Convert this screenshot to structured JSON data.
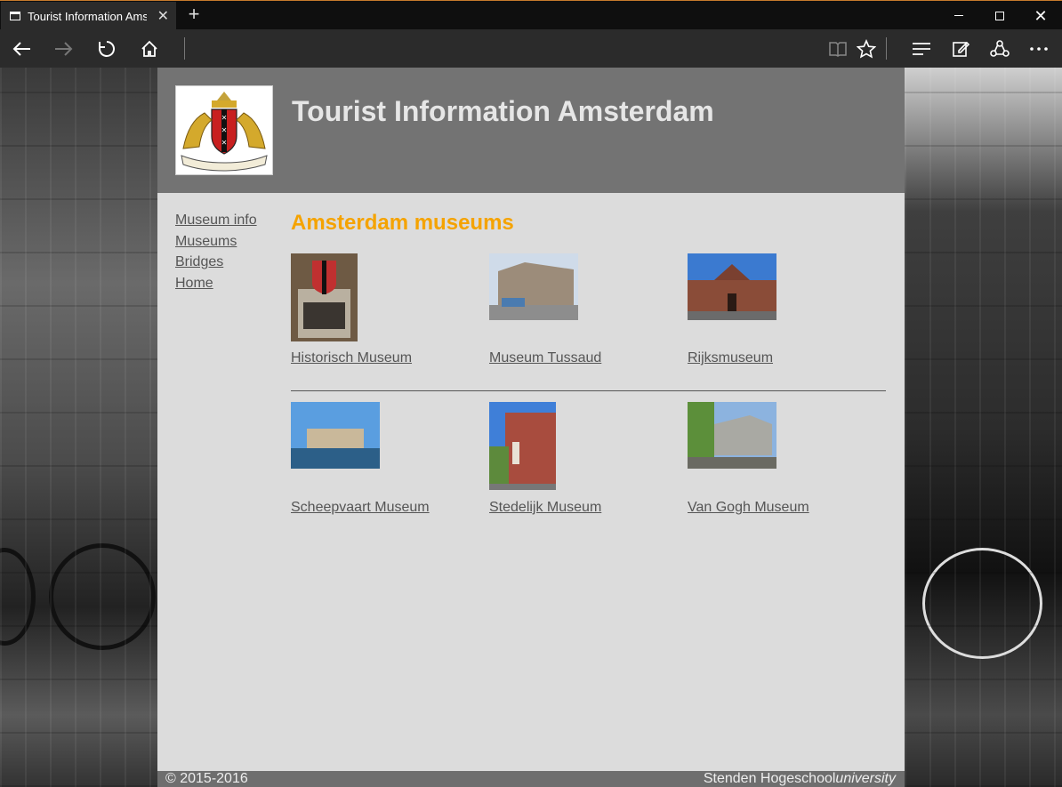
{
  "browser": {
    "tab_title": "Tourist Information Amst",
    "new_tab_symbol": "+",
    "close_tab_symbol": "✕",
    "icons": {
      "back": "back-arrow-icon",
      "forward": "forward-arrow-icon",
      "refresh": "refresh-icon",
      "home": "home-icon",
      "reading_view": "reading-view-icon",
      "favorite": "star-icon",
      "hub": "hub-icon",
      "notes": "web-note-icon",
      "share": "share-icon",
      "more": "more-icon"
    }
  },
  "header": {
    "title": "Tourist Information Amsterdam",
    "logo_icon": "amsterdam-coat-of-arms-icon"
  },
  "nav": {
    "items": [
      {
        "label": "Museum info"
      },
      {
        "label": "Museums"
      },
      {
        "label": "Bridges"
      },
      {
        "label": "Home"
      }
    ]
  },
  "main": {
    "title": "Amsterdam museums",
    "museums": [
      {
        "label": "Historisch Museum",
        "icon": "historisch-museum-photo",
        "color_a": "#8a6a4a",
        "color_b": "#c9c2b3"
      },
      {
        "label": "Museum Tussaud",
        "icon": "museum-tussaud-photo",
        "color_a": "#c8d8ea",
        "color_b": "#9a8a78"
      },
      {
        "label": "Rijksmuseum",
        "icon": "rijksmuseum-photo",
        "color_a": "#2c6fc7",
        "color_b": "#8a4a36"
      },
      {
        "label": "Scheepvaart Museum",
        "icon": "scheepvaart-museum-photo",
        "color_a": "#4d95d8",
        "color_b": "#2a5f86"
      },
      {
        "label": "Stedelijk Museum",
        "icon": "stedelijk-museum-photo",
        "color_a": "#2f6fd2",
        "color_b": "#a84a3c"
      },
      {
        "label": "Van Gogh Museum",
        "icon": "van-gogh-museum-photo",
        "color_a": "#6a9c42",
        "color_b": "#a7a7a2"
      }
    ]
  },
  "footer": {
    "copyright": "© 2015-2016",
    "credit_main": "Stenden Hogeschool",
    "credit_italic": "university"
  },
  "colors": {
    "title_orange": "#f5a300",
    "header_gray": "#737373",
    "content_bg": "#dcdcdc",
    "link_gray": "#555555"
  }
}
